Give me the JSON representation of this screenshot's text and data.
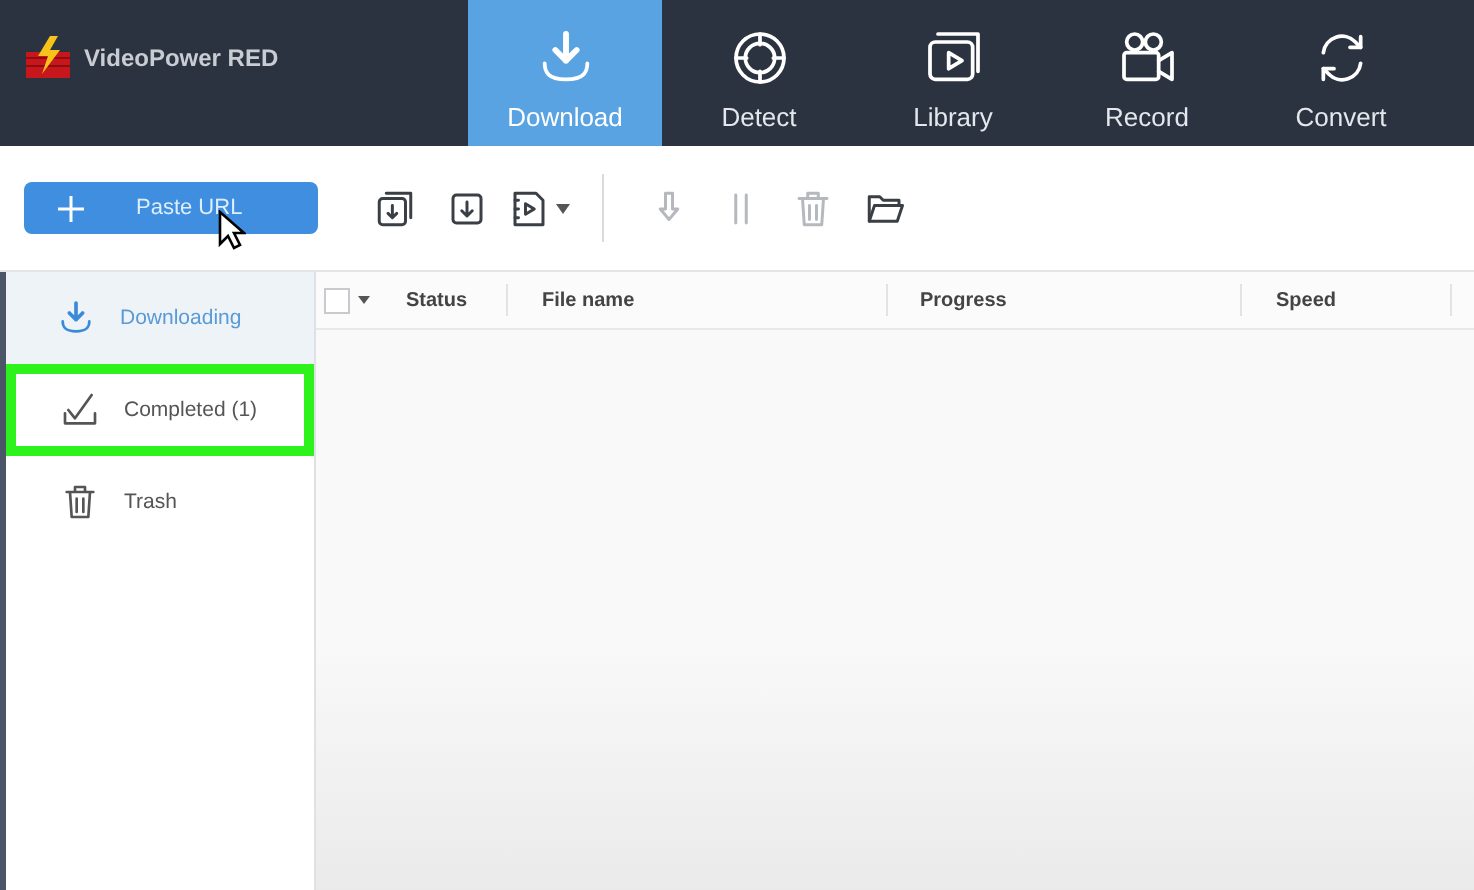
{
  "app": {
    "title": "VideoPower RED"
  },
  "tabs": [
    {
      "label": "Download",
      "selected": true
    },
    {
      "label": "Detect",
      "selected": false
    },
    {
      "label": "Library",
      "selected": false
    },
    {
      "label": "Record",
      "selected": false
    },
    {
      "label": "Convert",
      "selected": false
    }
  ],
  "toolbar": {
    "paste_button": "Paste URL",
    "tools": [
      {
        "kind": "button",
        "disabled": false,
        "menu": false
      },
      {
        "kind": "button",
        "disabled": false,
        "menu": false
      },
      {
        "kind": "button",
        "disabled": false,
        "menu": true
      },
      {
        "kind": "separator"
      },
      {
        "kind": "button",
        "disabled": true,
        "menu": false
      },
      {
        "kind": "button",
        "disabled": true,
        "menu": false
      },
      {
        "kind": "button",
        "disabled": true,
        "menu": false
      },
      {
        "kind": "button",
        "disabled": false,
        "menu": false
      }
    ]
  },
  "sidebar": {
    "items": [
      {
        "label": "Downloading",
        "selected": true,
        "highlighted": false
      },
      {
        "label": "Completed (1)",
        "selected": false,
        "highlighted": true
      },
      {
        "label": "Trash",
        "selected": false,
        "highlighted": false
      }
    ]
  },
  "table": {
    "select_all_checked": false,
    "columns": [
      "Status",
      "File name",
      "Progress",
      "Speed"
    ]
  }
}
